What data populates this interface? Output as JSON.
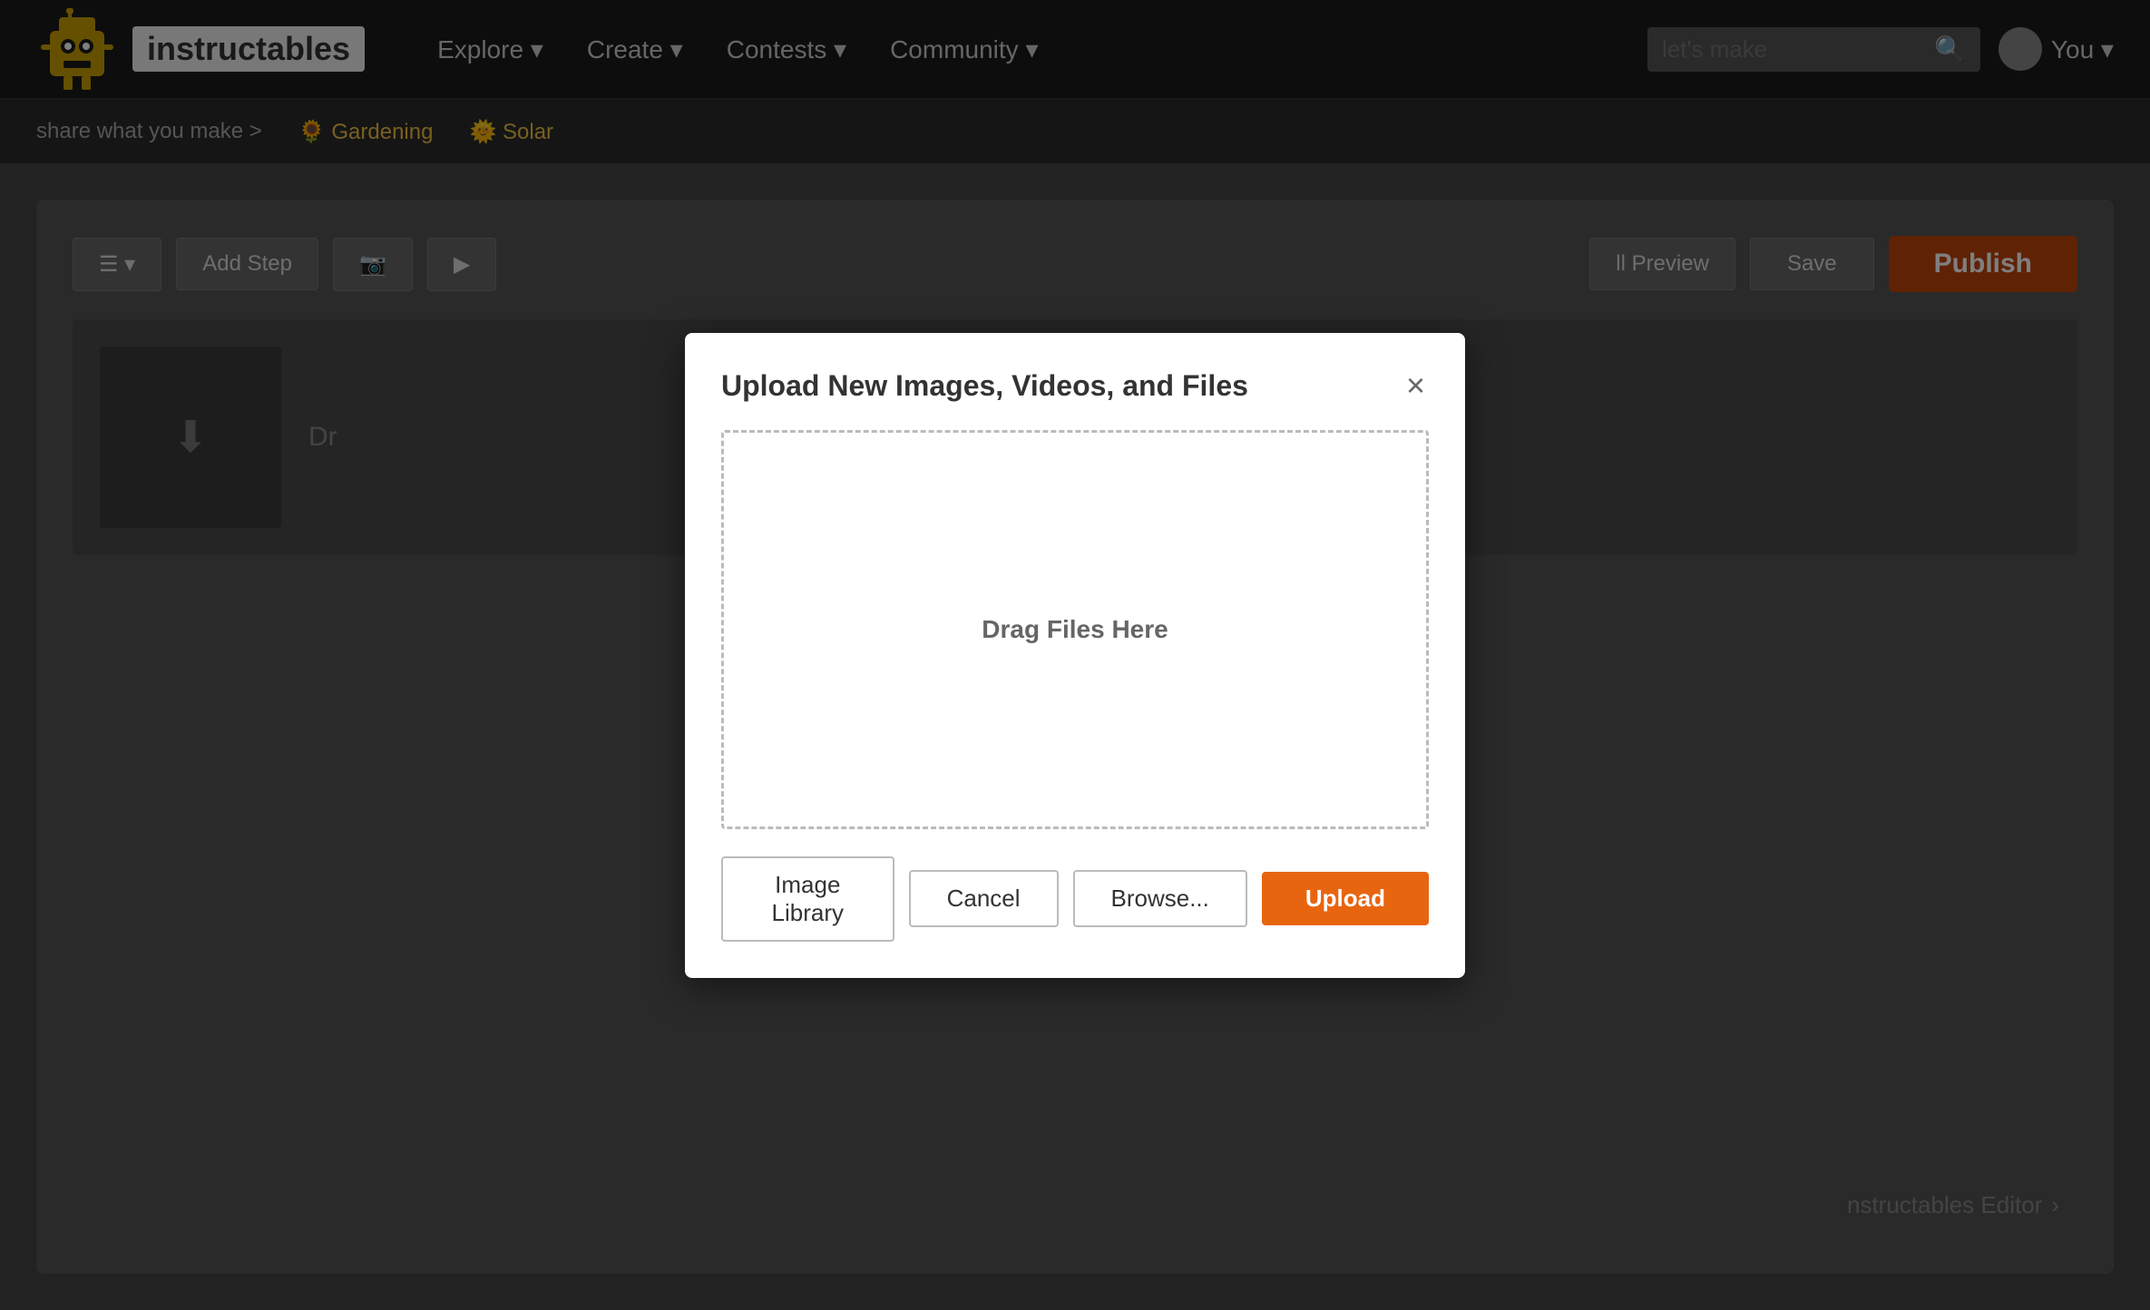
{
  "navbar": {
    "logo_text": "instructables",
    "explore_label": "Explore ▾",
    "create_label": "Create ▾",
    "contests_label": "Contests ▾",
    "community_label": "Community ▾",
    "search_placeholder": "let's make",
    "user_label": "You ▾"
  },
  "sub_navbar": {
    "share_text": "share what you make >",
    "gardening_label": "🌻 Gardening",
    "solar_label": "🌞 Solar"
  },
  "toolbar": {
    "add_step_label": "Add Step",
    "preview_label": "ll Preview",
    "save_label": "Save",
    "publish_label": "Publish"
  },
  "editor": {
    "step_text": "Dr",
    "instructables_editor_label": "nstructables Editor"
  },
  "modal": {
    "title": "Upload New Images, Videos, and Files",
    "close_label": "×",
    "drop_zone_text": "Drag Files Here",
    "image_library_label": "Image Library",
    "cancel_label": "Cancel",
    "browse_label": "Browse...",
    "upload_label": "Upload"
  }
}
